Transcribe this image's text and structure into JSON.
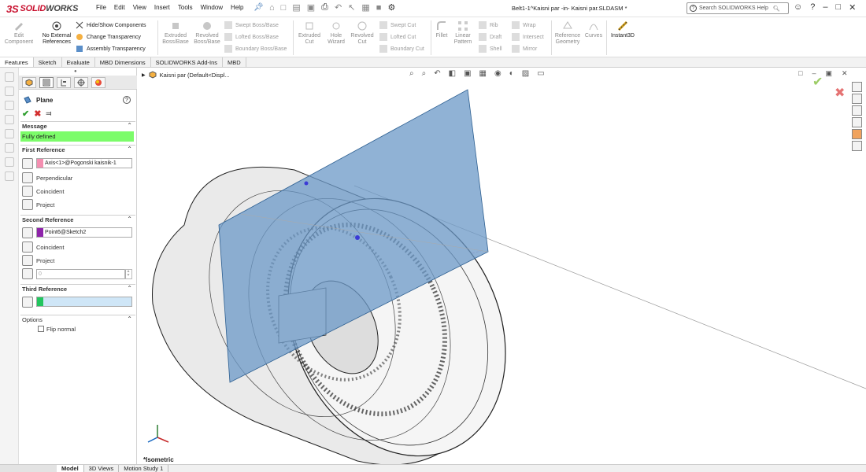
{
  "app": {
    "logo_ds": "3S",
    "logo_solid": "SOLID",
    "logo_works": "WORKS",
    "menu": [
      "File",
      "Edit",
      "View",
      "Insert",
      "Tools",
      "Window",
      "Help"
    ],
    "document_title": "Belt1-1^Kaisni par -in- Kaisni par.SLDASM *",
    "search_placeholder": "Search SOLIDWORKS Help"
  },
  "command_manager": {
    "edit_component": "Edit Component",
    "no_external_refs": "No External References",
    "hide_show": "Hide/Show Components",
    "change_transparency": "Change Transparency",
    "assembly_transparency": "Assembly Transparency",
    "extruded_boss": "Extruded Boss/Base",
    "revolved_boss": "Revolved Boss/Base",
    "swept_boss": "Swept Boss/Base",
    "lofted_boss": "Lofted Boss/Base",
    "boundary_boss": "Boundary Boss/Base",
    "extruded_cut": "Extruded Cut",
    "hole_wizard": "Hole Wizard",
    "revolved_cut": "Revolved Cut",
    "swept_cut": "Swept Cut",
    "lofted_cut": "Lofted Cut",
    "boundary_cut": "Boundary Cut",
    "fillet": "Fillet",
    "linear_pattern": "Linear Pattern",
    "rib": "Rib",
    "draft": "Draft",
    "shell": "Shell",
    "wrap": "Wrap",
    "intersect": "Intersect",
    "mirror": "Mirror",
    "reference_geometry": "Reference Geometry",
    "curves": "Curves",
    "instant3d": "Instant3D"
  },
  "tabs": [
    "Features",
    "Sketch",
    "Evaluate",
    "MBD Dimensions",
    "SOLIDWORKS Add-Ins",
    "MBD"
  ],
  "property_manager": {
    "title": "Plane",
    "message_header": "Message",
    "message": "Fully defined",
    "first_ref_header": "First Reference",
    "first_ref_value": "Axis<1>@Pogonski kaisnik-1",
    "first_ref_options": [
      "Perpendicular",
      "Coincident",
      "Project"
    ],
    "second_ref_header": "Second Reference",
    "second_ref_value": "Point6@Sketch2",
    "second_ref_options": [
      "Coincident",
      "Project"
    ],
    "second_ref_offset": "0",
    "third_ref_header": "Third Reference",
    "options_header": "Options",
    "flip_normal": "Flip normal"
  },
  "viewport": {
    "tree_item": "Kaisni par  (Default<Displ...",
    "view_name": "*Isometric"
  },
  "bottom_tabs": [
    "Model",
    "3D Views",
    "Motion Study 1"
  ],
  "colors": {
    "accent_blue": "#1a5ea8",
    "message_green": "#7cfc6a",
    "first_ref_swatch": "#f48fb1",
    "second_ref_swatch": "#8e24aa",
    "third_ref_swatch": "#22c55e",
    "plane_fill": "#6b98c7",
    "logo_red": "#c8102e"
  }
}
